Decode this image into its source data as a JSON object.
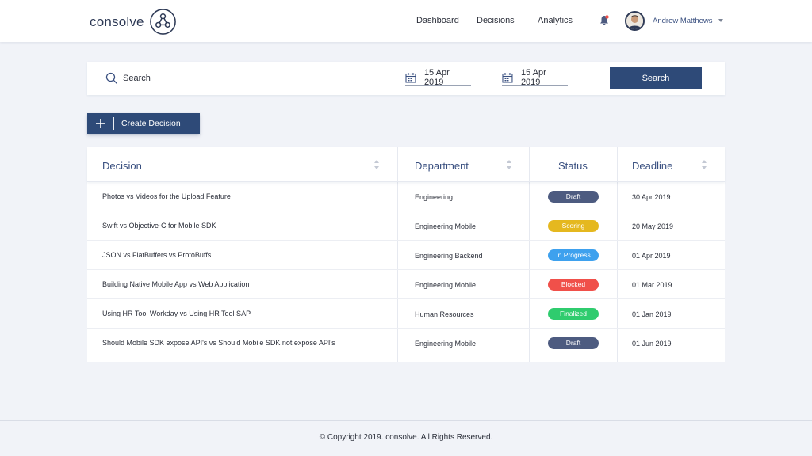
{
  "brand": {
    "name": "consolve"
  },
  "nav": {
    "dashboard": "Dashboard",
    "decisions": "Decisions",
    "analytics": "Analytics"
  },
  "user": {
    "name": "Andrew Matthews"
  },
  "icons": {
    "logo": "consolve-network-icon",
    "bell": "bell-icon",
    "search": "search-icon",
    "calendar": "calendar-icon",
    "plus": "plus-icon",
    "sort": "sort-icon",
    "caret": "chevron-down-icon"
  },
  "search": {
    "placeholder": "Search",
    "from_date": "15 Apr 2019",
    "to_date": "15 Apr 2019",
    "button_label": "Search"
  },
  "create": {
    "label": "Create Decision"
  },
  "table": {
    "headers": {
      "decision": "Decision",
      "department": "Department",
      "status": "Status",
      "deadline": "Deadline"
    },
    "rows": [
      {
        "decision": "Photos vs Videos for the Upload Feature",
        "department": "Engineering",
        "status": "Draft",
        "deadline": "30 Apr 2019"
      },
      {
        "decision": "Swift vs Objective-C for Mobile SDK",
        "department": "Engineering Mobile",
        "status": "Scoring",
        "deadline": "20 May 2019"
      },
      {
        "decision": "JSON vs FlatBuffers vs ProtoBuffs",
        "department": "Engineering Backend",
        "status": "In Progress",
        "deadline": "01 Apr 2019"
      },
      {
        "decision": "Building Native Mobile App vs Web Application",
        "department": "Engineering Mobile",
        "status": "Blocked",
        "deadline": "01 Mar 2019"
      },
      {
        "decision": "Using HR Tool Workday vs Using HR Tool SAP",
        "department": "Human Resources",
        "status": "Finalized",
        "deadline": "01 Jan 2019"
      },
      {
        "decision": "Should Mobile SDK expose API's vs Should Mobile SDK not expose API's",
        "department": "Engineering Mobile",
        "status": "Draft",
        "deadline": "01 Jun 2019"
      }
    ]
  },
  "status_colors": {
    "Draft": "#4d5b80",
    "Scoring": "#e5b81f",
    "In Progress": "#3ea1ee",
    "Blocked": "#f0504a",
    "Finalized": "#2fcc6e"
  },
  "colors": {
    "accent": "#2e4a78",
    "header_text": "#3a5080",
    "background": "#f1f3f8"
  },
  "footer": {
    "copyright": "© Copyright 2019. consolve. All Rights Reserved."
  }
}
